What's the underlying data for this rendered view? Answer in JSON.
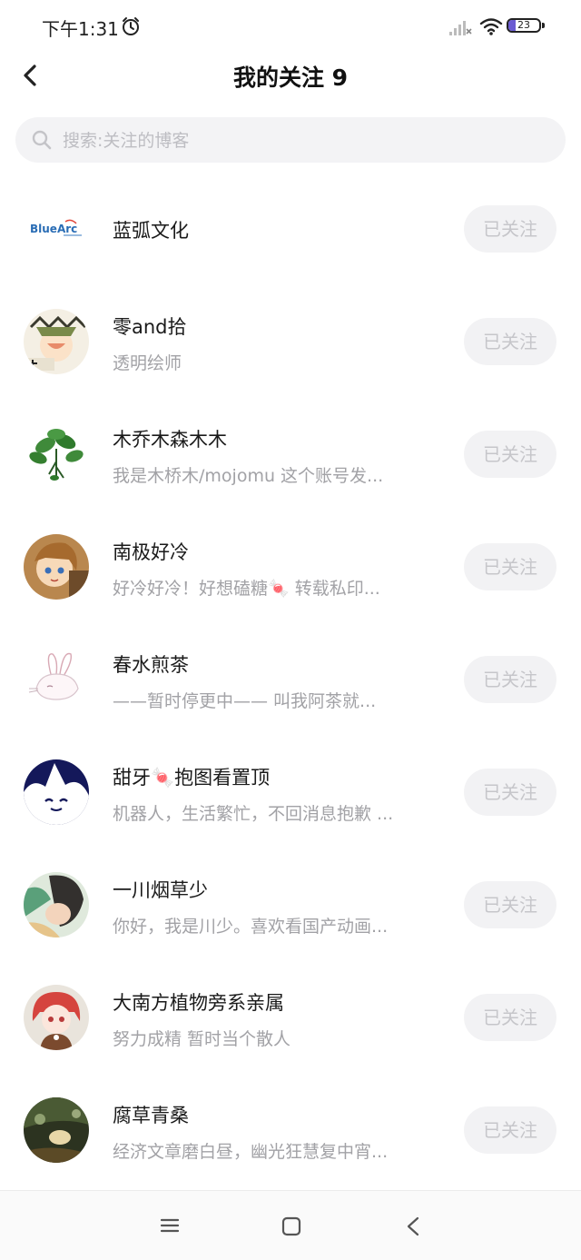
{
  "status_bar": {
    "time": "下午1:31",
    "battery_level": "23",
    "battery_percent": 23,
    "icons": [
      "alarm-icon",
      "signal-icon",
      "wifi-icon",
      "battery-icon"
    ]
  },
  "header": {
    "title": "我的关注 9",
    "back_icon": "chevron-left-icon"
  },
  "search": {
    "placeholder": "搜索:关注的博客",
    "value": ""
  },
  "follow_list": [
    {
      "name": "蓝弧文化",
      "desc": "",
      "button": "已关注"
    },
    {
      "name": "零and拾",
      "desc": "透明绘师",
      "button": "已关注"
    },
    {
      "name": "木乔木森木木",
      "desc": "我是木桥木/mojomu 这个账号发...",
      "button": "已关注"
    },
    {
      "name": "南极好冷",
      "desc": "好冷好冷！好想磕糖🍬 转载私印...",
      "button": "已关注"
    },
    {
      "name": "春水煎茶",
      "desc": "——暂时停更中—— 叫我阿茶就...",
      "button": "已关注"
    },
    {
      "name": "甜牙🍬抱图看置顶",
      "desc": "机器人，生活繁忙，不回消息抱歉 ...",
      "button": "已关注"
    },
    {
      "name": "一川烟草少",
      "desc": "你好，我是川少。喜欢看国产动画...",
      "button": "已关注"
    },
    {
      "name": "大南方植物旁系亲属",
      "desc": "努力成精 暂时当个散人",
      "button": "已关注"
    },
    {
      "name": "腐草青桑",
      "desc": "经济文章磨白昼，幽光狂慧复中宵...",
      "button": "已关注"
    }
  ],
  "avatar_logo_text": "BlueArc",
  "nav_bar": {
    "icons": [
      "menu-icon",
      "home-square-icon",
      "back-triangle-icon"
    ]
  },
  "colors": {
    "button_bg": "#f2f2f4",
    "button_text": "#c6c6ca",
    "desc_text": "#a2a2a6",
    "search_bg": "#f3f3f5",
    "battery_fill": "#6b5bd2"
  }
}
